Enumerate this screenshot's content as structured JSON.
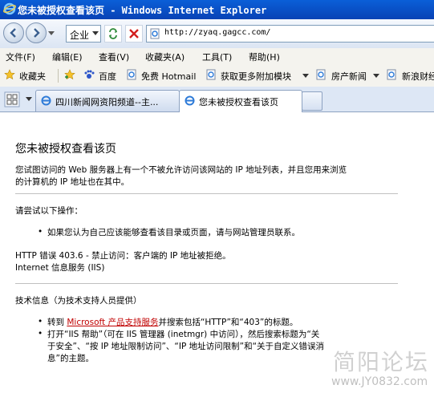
{
  "window": {
    "title": "您未被授权查看该页 - Windows Internet Explorer"
  },
  "address": {
    "combo": "企业",
    "url": "http://zyaq.gagcc.com/"
  },
  "menu": [
    "文件(F)",
    "编辑(E)",
    "查看(V)",
    "收藏夹(A)",
    "工具(T)",
    "帮助(H)"
  ],
  "links": {
    "favorites": "收藏夹",
    "items": [
      "百度",
      "免费 Hotmail",
      "获取更多附加模块",
      "房产新闻",
      "新浪财经"
    ]
  },
  "tabs": [
    {
      "label": "四川新闻网资阳频道--主...",
      "active": false
    },
    {
      "label": "您未被授权查看该页",
      "active": true
    }
  ],
  "page": {
    "title": "您未被授权查看该页",
    "intro_1": "您试图访问的 Web 服务器上有一个不被允许访问该网站的 IP 地址列表，并且您用来浏览",
    "intro_2": "的计算机的 IP 地址也在其中。",
    "try_heading": "请尝试以下操作：",
    "try_item": "如果您认为自己应该能够查看该目录或页面，请与网站管理员联系。",
    "error_1": "HTTP 错误 403.6 - 禁止访问：客户端的 IP 地址被拒绝。",
    "error_2": "Internet 信息服务 (IIS)",
    "tech_heading": "技术信息（为技术支持人员提供）",
    "tech_1_pre": "转到 ",
    "tech_1_link": "Microsoft 产品支持服务",
    "tech_1_post": "并搜索包括“HTTP”和“403”的标题。",
    "tech_2_a": "打开“IIS 帮助”（可在 IIS 管理器 (inetmgr) 中访问），然后搜索标题为“关",
    "tech_2_b": "于安全”、“按 IP 地址限制访问”、“IP 地址访问限制”和“关于自定义错误消",
    "tech_2_c": "息”的主题。",
    "watermark_cn": "简阳论坛",
    "watermark_url": "www.JY0832.com"
  }
}
